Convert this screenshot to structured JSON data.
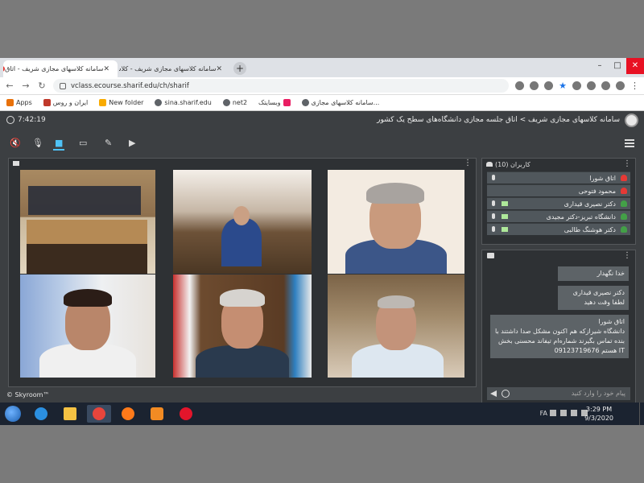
{
  "browser": {
    "tabs": [
      {
        "title": "سامانه کلاسهای مجازی شریف - اتاق",
        "active": true,
        "recording": true
      },
      {
        "title": "سامانه کلاسهای مجازی شریف - کلاس مد",
        "active": false,
        "recording": false
      },
      {
        "title": "سامانه کلاسهای مجازی شریف - کلاس د",
        "active": false,
        "recording": false
      }
    ],
    "new_tab": "+",
    "window_controls": [
      "–",
      "□",
      "✕"
    ],
    "url": "vclass.ecourse.sharif.edu/ch/sharif",
    "bookmarks": [
      {
        "label": "Apps",
        "color": "#e8710a"
      },
      {
        "label": "ایران و روس",
        "color": "#c0392b"
      },
      {
        "label": "New folder",
        "color": "#f9ab00"
      },
      {
        "label": "sina.sharif.edu",
        "color": "#5f6368"
      },
      {
        "label": "net2",
        "color": "#5f6368"
      },
      {
        "label": "وبسایتک",
        "color": "#e91e63"
      },
      {
        "label": "سامانه کلاسهای مجازی...",
        "color": "#5f6368"
      }
    ]
  },
  "app": {
    "clock": "7:42:19",
    "breadcrumb": "سامانه کلاسهای مجازی شریف > اتاق جلسه مجازی دانشگاه‌های سطح یک کشور",
    "brand": "© Skyroom™"
  },
  "users_panel": {
    "title": "کاربران (10)",
    "users": [
      {
        "name": "اتاق شورا",
        "status": "#e53935",
        "mic": true,
        "cam": false
      },
      {
        "name": "محمود فتوحی",
        "status": "#e53935",
        "mic": false,
        "cam": false
      },
      {
        "name": "دکتر نصیری قیداری",
        "status": "#43a047",
        "mic": true,
        "cam": true
      },
      {
        "name": "دانشگاه تبریز-دکتر مجیدی",
        "status": "#43a047",
        "mic": true,
        "cam": true
      },
      {
        "name": "دکتر هوشنگ طالبی",
        "status": "#43a047",
        "mic": true,
        "cam": true
      }
    ]
  },
  "chat": {
    "messages": [
      {
        "lines": [
          "خدا نگهدار"
        ]
      },
      {
        "lines": [
          "دکتر نصیری قیداری",
          "لطفا وقت دهید"
        ]
      },
      {
        "lines": [
          "اتاق شورا",
          "دانشگاه شیرازکه هم اکنون مشکل صدا داشتند با",
          "بنده تماس بگیرند شماره‌ام تیفاند    محسنی بخش",
          "IT    هستم 09123719676"
        ]
      }
    ],
    "placeholder": "پیام خود را وارد کنید"
  },
  "taskbar": {
    "language": "FA",
    "time": "3:29 PM",
    "date": "9/3/2020",
    "apps": [
      {
        "name": "ie-icon",
        "color": "#2b8fe0"
      },
      {
        "name": "folder-icon",
        "color": "#f5c243"
      },
      {
        "name": "chrome-icon",
        "color": "#e8453c"
      },
      {
        "name": "firefox-icon",
        "color": "#ff7a1a"
      },
      {
        "name": "media-player-icon",
        "color": "#f28b23"
      },
      {
        "name": "opera-icon",
        "color": "#e3152b"
      }
    ]
  }
}
